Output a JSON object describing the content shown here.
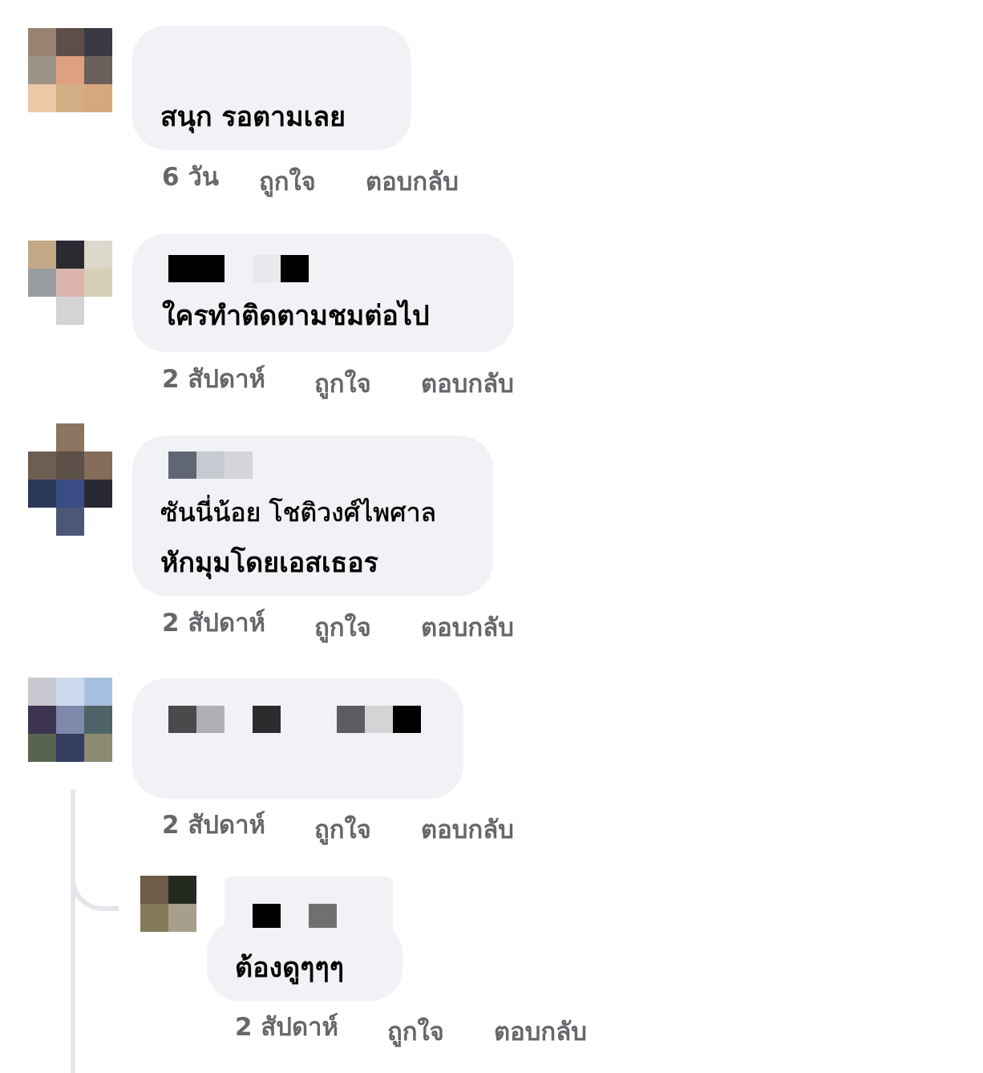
{
  "comments": [
    {
      "text_lines": [
        "สนุก รอตามเลย"
      ],
      "time": "6 วัน",
      "like_label": "ถูกใจ",
      "reply_label": "ตอบกลับ"
    },
    {
      "text_lines": [
        "ใครทำติดตามชมต่อไป"
      ],
      "time": "2 สัปดาห์",
      "like_label": "ถูกใจ",
      "reply_label": "ตอบกลับ"
    },
    {
      "text_lines": [
        "ซันนี่น้อย โชติวงศ์ไพศาล",
        "หักมุมโดยเอสเธอร"
      ],
      "time": "2 สัปดาห์",
      "like_label": "ถูกใจ",
      "reply_label": "ตอบกลับ"
    },
    {
      "text_lines": [],
      "time": "2 สัปดาห์",
      "like_label": "ถูกใจ",
      "reply_label": "ตอบกลับ"
    }
  ],
  "reply": {
    "text_lines": [
      "ต้องดูๆๆๆ"
    ],
    "time": "2 สัปดาห์",
    "like_label": "ถูกใจ",
    "reply_label": "ตอบกลับ"
  },
  "colors": {
    "bubble": "#f0f2f5",
    "meta_text": "#65676b",
    "comment_text": "#050505"
  }
}
